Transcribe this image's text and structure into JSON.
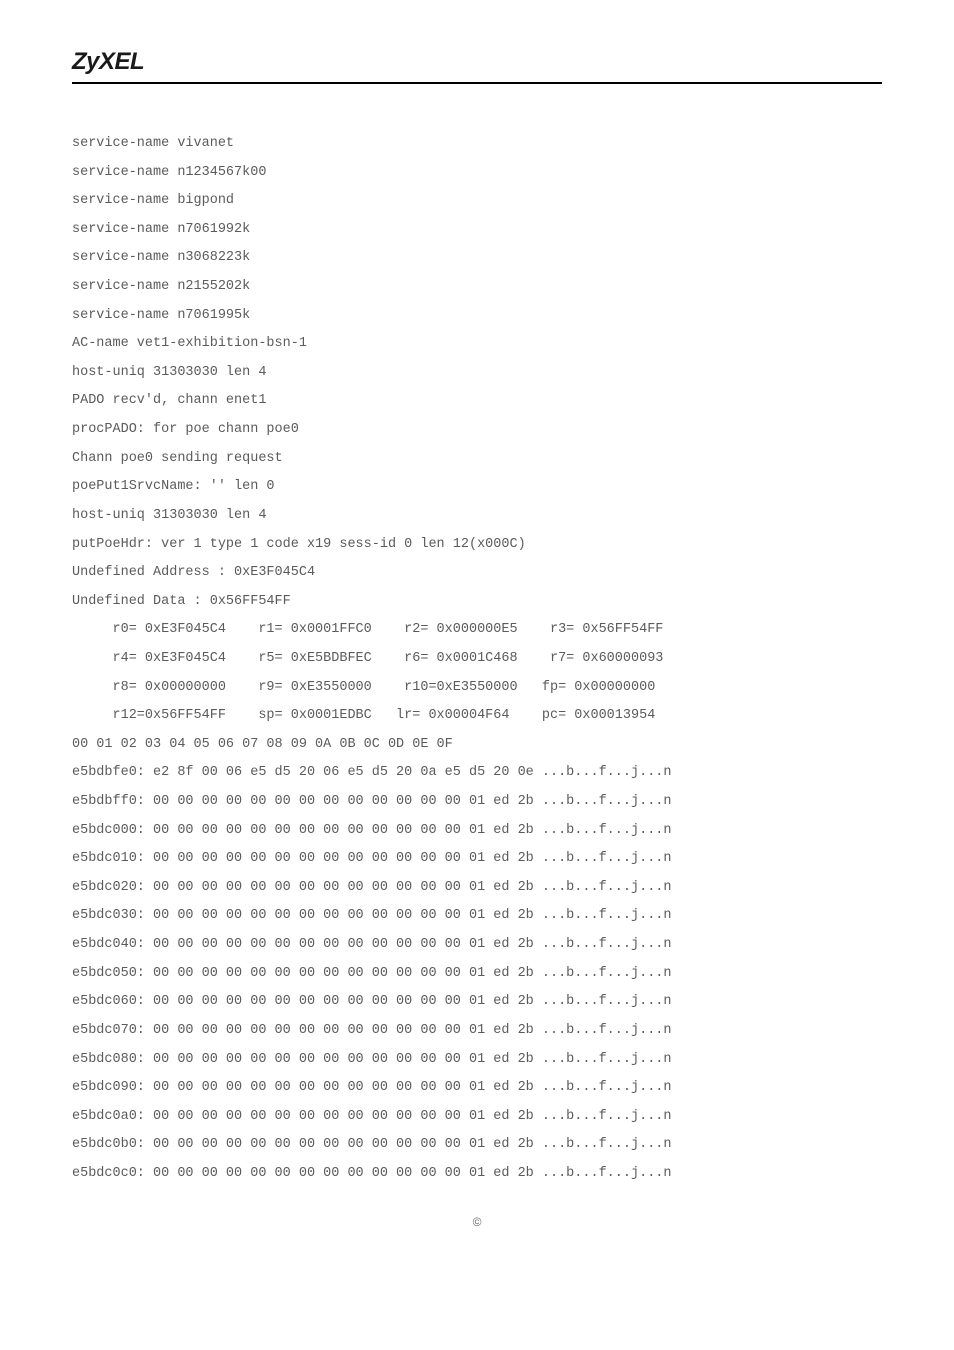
{
  "header": {
    "brand": "ZyXEL"
  },
  "footer": {
    "copyright": "©"
  },
  "log": {
    "lines": [
      "service-name vivanet",
      "service-name n1234567k00",
      "service-name bigpond",
      "service-name n7061992k",
      "service-name n3068223k",
      "service-name n2155202k",
      "service-name n7061995k",
      "AC-name vet1-exhibition-bsn-1",
      "host-uniq 31303030 len 4",
      "PADO recv'd, chann enet1",
      "procPADO: for poe chann poe0",
      "Chann poe0 sending request",
      "poePut1SrvcName: '' len 0",
      "host-uniq 31303030 len 4",
      "putPoeHdr: ver 1 type 1 code x19 sess-id 0 len 12(x000C)",
      "Undefined Address : 0xE3F045C4",
      "Undefined Data : 0x56FF54FF",
      "     r0= 0xE3F045C4    r1= 0x0001FFC0    r2= 0x000000E5    r3= 0x56FF54FF",
      "     r4= 0xE3F045C4    r5= 0xE5BDBFEC    r6= 0x0001C468    r7= 0x60000093",
      "     r8= 0x00000000    r9= 0xE3550000    r10=0xE3550000   fp= 0x00000000",
      "     r12=0x56FF54FF    sp= 0x0001EDBC   lr= 0x00004F64    pc= 0x00013954",
      "00 01 02 03 04 05 06 07 08 09 0A 0B 0C 0D 0E 0F",
      "e5bdbfe0: e2 8f 00 06 e5 d5 20 06 e5 d5 20 0a e5 d5 20 0e ...b...f...j...n",
      "e5bdbff0: 00 00 00 00 00 00 00 00 00 00 00 00 00 01 ed 2b ...b...f...j...n",
      "e5bdc000: 00 00 00 00 00 00 00 00 00 00 00 00 00 01 ed 2b ...b...f...j...n",
      "e5bdc010: 00 00 00 00 00 00 00 00 00 00 00 00 00 01 ed 2b ...b...f...j...n",
      "e5bdc020: 00 00 00 00 00 00 00 00 00 00 00 00 00 01 ed 2b ...b...f...j...n",
      "e5bdc030: 00 00 00 00 00 00 00 00 00 00 00 00 00 01 ed 2b ...b...f...j...n",
      "e5bdc040: 00 00 00 00 00 00 00 00 00 00 00 00 00 01 ed 2b ...b...f...j...n",
      "e5bdc050: 00 00 00 00 00 00 00 00 00 00 00 00 00 01 ed 2b ...b...f...j...n",
      "e5bdc060: 00 00 00 00 00 00 00 00 00 00 00 00 00 01 ed 2b ...b...f...j...n",
      "e5bdc070: 00 00 00 00 00 00 00 00 00 00 00 00 00 01 ed 2b ...b...f...j...n",
      "e5bdc080: 00 00 00 00 00 00 00 00 00 00 00 00 00 01 ed 2b ...b...f...j...n",
      "e5bdc090: 00 00 00 00 00 00 00 00 00 00 00 00 00 01 ed 2b ...b...f...j...n",
      "e5bdc0a0: 00 00 00 00 00 00 00 00 00 00 00 00 00 01 ed 2b ...b...f...j...n",
      "e5bdc0b0: 00 00 00 00 00 00 00 00 00 00 00 00 00 01 ed 2b ...b...f...j...n",
      "e5bdc0c0: 00 00 00 00 00 00 00 00 00 00 00 00 00 01 ed 2b ...b...f...j...n"
    ]
  }
}
